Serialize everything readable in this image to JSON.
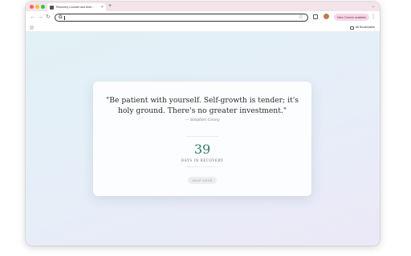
{
  "browser": {
    "tab_title": "Recovery Counter and Moti...",
    "new_tab_symbol": "+",
    "close_symbol": "×",
    "omnibox_value": "",
    "new_chrome_label": "New Chrome available",
    "all_bookmarks_label": "All Bookmarks",
    "colors": {
      "tabstrip": "#f3e3ea",
      "new_chrome_bg": "#f6d7e5"
    }
  },
  "quote": {
    "text": "\"Be patient with yourself. Self-growth is tender; it's holy ground. There's no greater investment.\"",
    "author": "— Stephen Covey"
  },
  "counter": {
    "value": "39",
    "label": "DAYS IN RECOVERY",
    "color": "#2e7b69"
  },
  "tag": {
    "label": "SELF-LOVE"
  },
  "icons": [
    "back-arrow-icon",
    "forward-arrow-icon",
    "reload-icon",
    "google-icon",
    "star-icon",
    "extensions-icon",
    "kebab-menu-icon",
    "apps-grid-icon",
    "folder-icon"
  ]
}
